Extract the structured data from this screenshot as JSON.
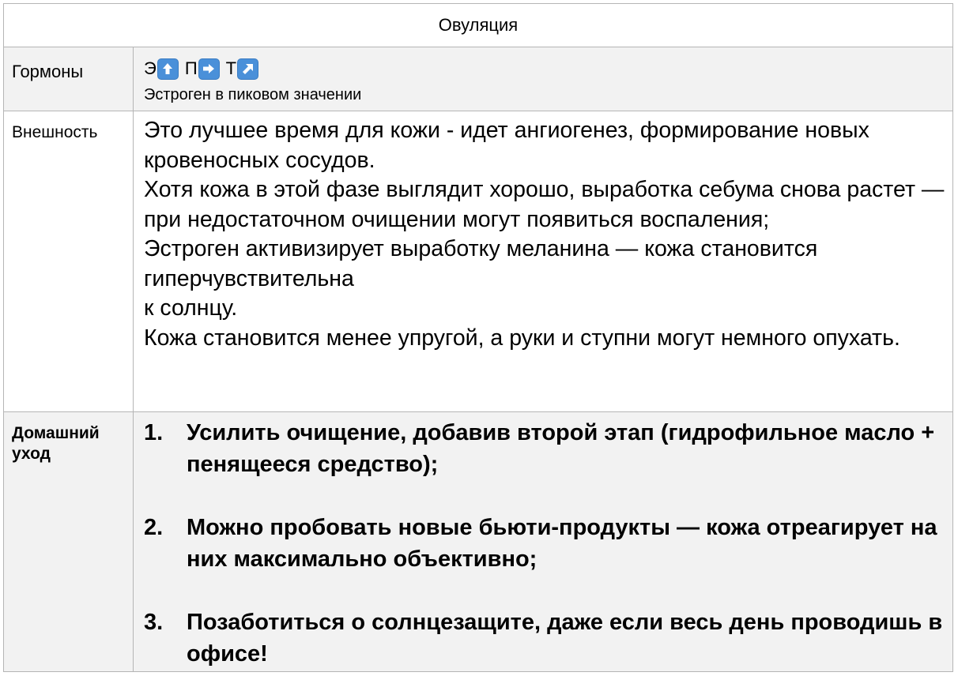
{
  "header": {
    "title": "Овуляция"
  },
  "rows": {
    "hormones": {
      "label": "Гормоны",
      "items": [
        {
          "letter": "Э",
          "arrow_icon": "arrow-up-icon"
        },
        {
          "letter": "П",
          "arrow_icon": "arrow-right-icon"
        },
        {
          "letter": "Т",
          "arrow_icon": "arrow-up-right-icon"
        }
      ],
      "note": "Эстроген в пиковом значении"
    },
    "appearance": {
      "label": "Внешность",
      "lines": [
        "Это лучшее время для кожи - идет ангиогенез, формирование новых кровеносных сосудов.",
        "Хотя кожа в этой фазе выглядит хорошо, выработка себума снова растет — при недостаточном очищении могут появиться воспаления;",
        "Эстроген активизирует выработку меланина — кожа становится гиперчувствительна",
        "к солнцу.",
        "Кожа становится менее упругой, а руки и ступни могут немного опухать."
      ]
    },
    "care": {
      "label": "Домашний уход",
      "items": [
        {
          "num": "1.",
          "text": "Усилить очищение, добавив второй этап (гидрофильное масло + пенящееся средство);"
        },
        {
          "num": "2.",
          "text": "Можно пробовать новые бьюти-продукты — кожа отреагирует на них максимально объективно;"
        },
        {
          "num": "3.",
          "text": "Позаботиться о солнцезащите, даже если весь день проводишь в офисе!"
        }
      ]
    }
  },
  "colors": {
    "arrow_box": "#4a90d9",
    "shaded_cell": "#f2f2f2",
    "border": "#b5b5b5"
  }
}
